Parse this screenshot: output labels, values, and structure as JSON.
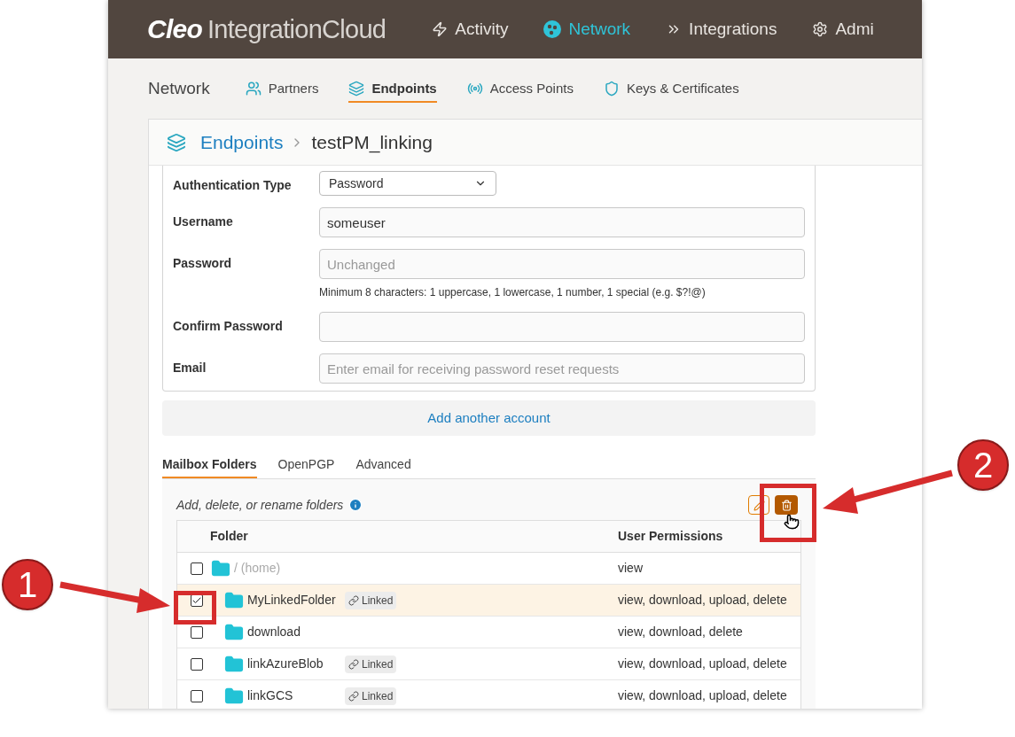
{
  "header": {
    "logo_bold": "Cleo",
    "logo_text": "IntegrationCloud",
    "nav": [
      {
        "label": "Activity",
        "selected": false
      },
      {
        "label": "Network",
        "selected": true
      },
      {
        "label": "Integrations",
        "selected": false
      },
      {
        "label": "Admi",
        "selected": false
      }
    ]
  },
  "subnav": {
    "title": "Network",
    "tabs": [
      {
        "label": "Partners",
        "selected": false
      },
      {
        "label": "Endpoints",
        "selected": true
      },
      {
        "label": "Access Points",
        "selected": false
      },
      {
        "label": "Keys & Certificates",
        "selected": false
      }
    ]
  },
  "breadcrumb": {
    "parent": "Endpoints",
    "current": "testPM_linking"
  },
  "form": {
    "fields": [
      {
        "label": "Authentication Type",
        "kind": "select",
        "value": "Password"
      },
      {
        "label": "Username",
        "kind": "text",
        "value": "someuser"
      },
      {
        "label": "Password",
        "kind": "text",
        "placeholder": "Unchanged",
        "hint": "Minimum 8 characters: 1 uppercase, 1 lowercase, 1 number, 1 special (e.g. $?!@)"
      },
      {
        "label": "Confirm Password",
        "kind": "text"
      },
      {
        "label": "Email",
        "kind": "text",
        "placeholder": "Enter email for receiving password reset requests"
      }
    ]
  },
  "add_account": "Add another account",
  "folder_tabs": [
    {
      "label": "Mailbox Folders",
      "selected": true
    },
    {
      "label": "OpenPGP",
      "selected": false
    },
    {
      "label": "Advanced",
      "selected": false
    }
  ],
  "folders": {
    "description": "Add, delete, or rename folders",
    "columns": [
      "Folder",
      "User Permissions"
    ],
    "rows": [
      {
        "kind": "root",
        "name": "/ (home)",
        "permissions": "view",
        "checked": false,
        "selected": false
      },
      {
        "kind": "folder",
        "name": "MyLinkedFolder",
        "badge": "Linked",
        "permissions": "view, download, upload, delete",
        "checked": true,
        "selected": true
      },
      {
        "kind": "folder",
        "name": "download",
        "permissions": "view, download, delete",
        "checked": false,
        "selected": false
      },
      {
        "kind": "folder",
        "name": "linkAzureBlob",
        "badge": "Linked",
        "permissions": "view, download, upload, delete",
        "checked": false,
        "selected": false
      },
      {
        "kind": "folder",
        "name": "linkGCS",
        "badge": "Linked",
        "permissions": "view, download, upload, delete",
        "checked": false,
        "selected": false
      }
    ]
  },
  "annotations": [
    {
      "label": "1"
    },
    {
      "label": "2"
    }
  ]
}
